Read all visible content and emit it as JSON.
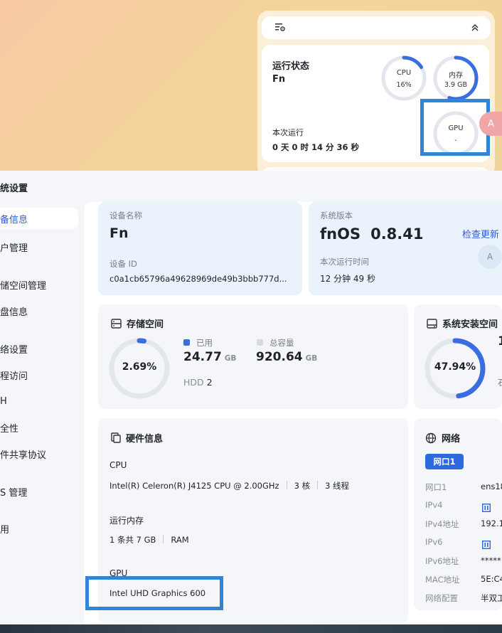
{
  "widget": {
    "title": "运行状态",
    "device_name": "Fn",
    "uptime_label": "本次运行",
    "uptime": "0 天 0 时 14 分 36 秒",
    "cpu": {
      "label": "CPU",
      "value": "16%",
      "fraction": 0.16
    },
    "memory": {
      "label": "内存",
      "value": "3.9 GB",
      "fraction": 0.55
    },
    "gpu": {
      "label": "GPU",
      "value": "-",
      "fraction": 0
    },
    "translate_glyph": "A"
  },
  "window": {
    "title": "统设置",
    "sidebar": [
      "备信息",
      "户管理",
      "储空间管理",
      "盘信息",
      "络设置",
      "程访问",
      "H",
      "全性",
      "件共享协议",
      "S 管理",
      "用"
    ],
    "active_index": 0
  },
  "device": {
    "name_label": "设备名称",
    "name": "Fn",
    "id_label": "设备 ID",
    "id": "c0a1cb65796a49628969de49b3bbb777d...",
    "version_label": "系统版本",
    "os_name": "fnOS",
    "os_version": "0.8.41",
    "check_update": "检查更新",
    "uptime_label": "本次运行时间",
    "uptime": "12 分钟 49 秒"
  },
  "storage": {
    "title": "存储空间",
    "percent": "2.69%",
    "fraction": 0.0269,
    "used_label": "已用",
    "used_value": "24.77",
    "used_unit": "GB",
    "total_label": "总容量",
    "total_value": "920.64",
    "total_unit": "GB",
    "disk_type": "HDD",
    "disk_count": "2",
    "colors": {
      "used": "#3a6ee0",
      "track": "#e1e4ea",
      "total": "#d8dbe1"
    }
  },
  "system_disk": {
    "title": "系统安装空间",
    "percent": "47.94%",
    "fraction": 0.4794,
    "used_clip": "1",
    "total_clip": "石"
  },
  "hardware": {
    "title": "硬件信息",
    "cpu_label": "CPU",
    "cpu_model": "Intel(R) Celeron(R) J4125 CPU @ 2.00GHz",
    "cpu_cores": "3 核",
    "cpu_threads": "3 线程",
    "ram_label": "运行内存",
    "ram_sticks": "1 条共 7 GB",
    "ram_type": "RAM",
    "gpu_label": "GPU",
    "gpu_model": "Intel UHD Graphics 600"
  },
  "network": {
    "title": "网络",
    "tab": "网口1",
    "rows": [
      {
        "key": "网口1",
        "value": "ens18"
      },
      {
        "key": "IPv4",
        "value": ""
      },
      {
        "key": "IPv4地址",
        "value": "192.1("
      },
      {
        "key": "IPv6",
        "value": ""
      },
      {
        "key": "IPv6地址",
        "value": "*****"
      },
      {
        "key": "MAC地址",
        "value": "5E:C4"
      },
      {
        "key": "网络配置",
        "value": "半双工"
      }
    ]
  }
}
